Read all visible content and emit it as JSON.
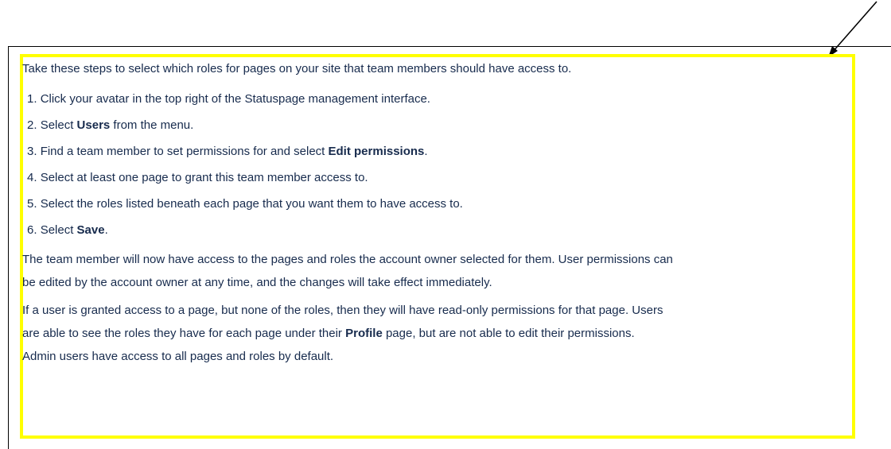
{
  "document": {
    "intro": "Take these steps to select which roles for pages on your site that team members should have access to.",
    "steps": [
      {
        "num": "1.",
        "pre": "Click your avatar in the top right of the Statuspage management interface.",
        "bold": "",
        "post": ""
      },
      {
        "num": "2.",
        "pre": "Select ",
        "bold": "Users",
        "post": " from the menu."
      },
      {
        "num": "3.",
        "pre": "Find a team member to set permissions for and select ",
        "bold": "Edit permissions",
        "post": "."
      },
      {
        "num": "4.",
        "pre": "Select at least one page to grant this team member access to.",
        "bold": "",
        "post": ""
      },
      {
        "num": "5.",
        "pre": "Select the roles listed beneath each page that you want them to have access to.",
        "bold": "",
        "post": ""
      },
      {
        "num": "6.",
        "pre": "Select ",
        "bold": "Save",
        "post": "."
      }
    ],
    "paragraph1": {
      "line1": "The team member will now have access to the pages and roles the account owner selected for them. User permissions can",
      "line2": "be edited by the account owner at any time, and the changes will take effect immediately."
    },
    "paragraph2": {
      "line1": "If a user is granted access to a page, but none of the roles, then they will have read-only permissions for that page. Users",
      "line2_pre": "are able to see the roles they have for each page under their ",
      "line2_bold": "Profile",
      "line2_post": " page, but are not able to edit their permissions.",
      "line3": "Admin users have access to all pages and roles by default."
    }
  },
  "colors": {
    "highlight": "#ffff00",
    "text": "#172b4d",
    "frame": "#000000"
  }
}
